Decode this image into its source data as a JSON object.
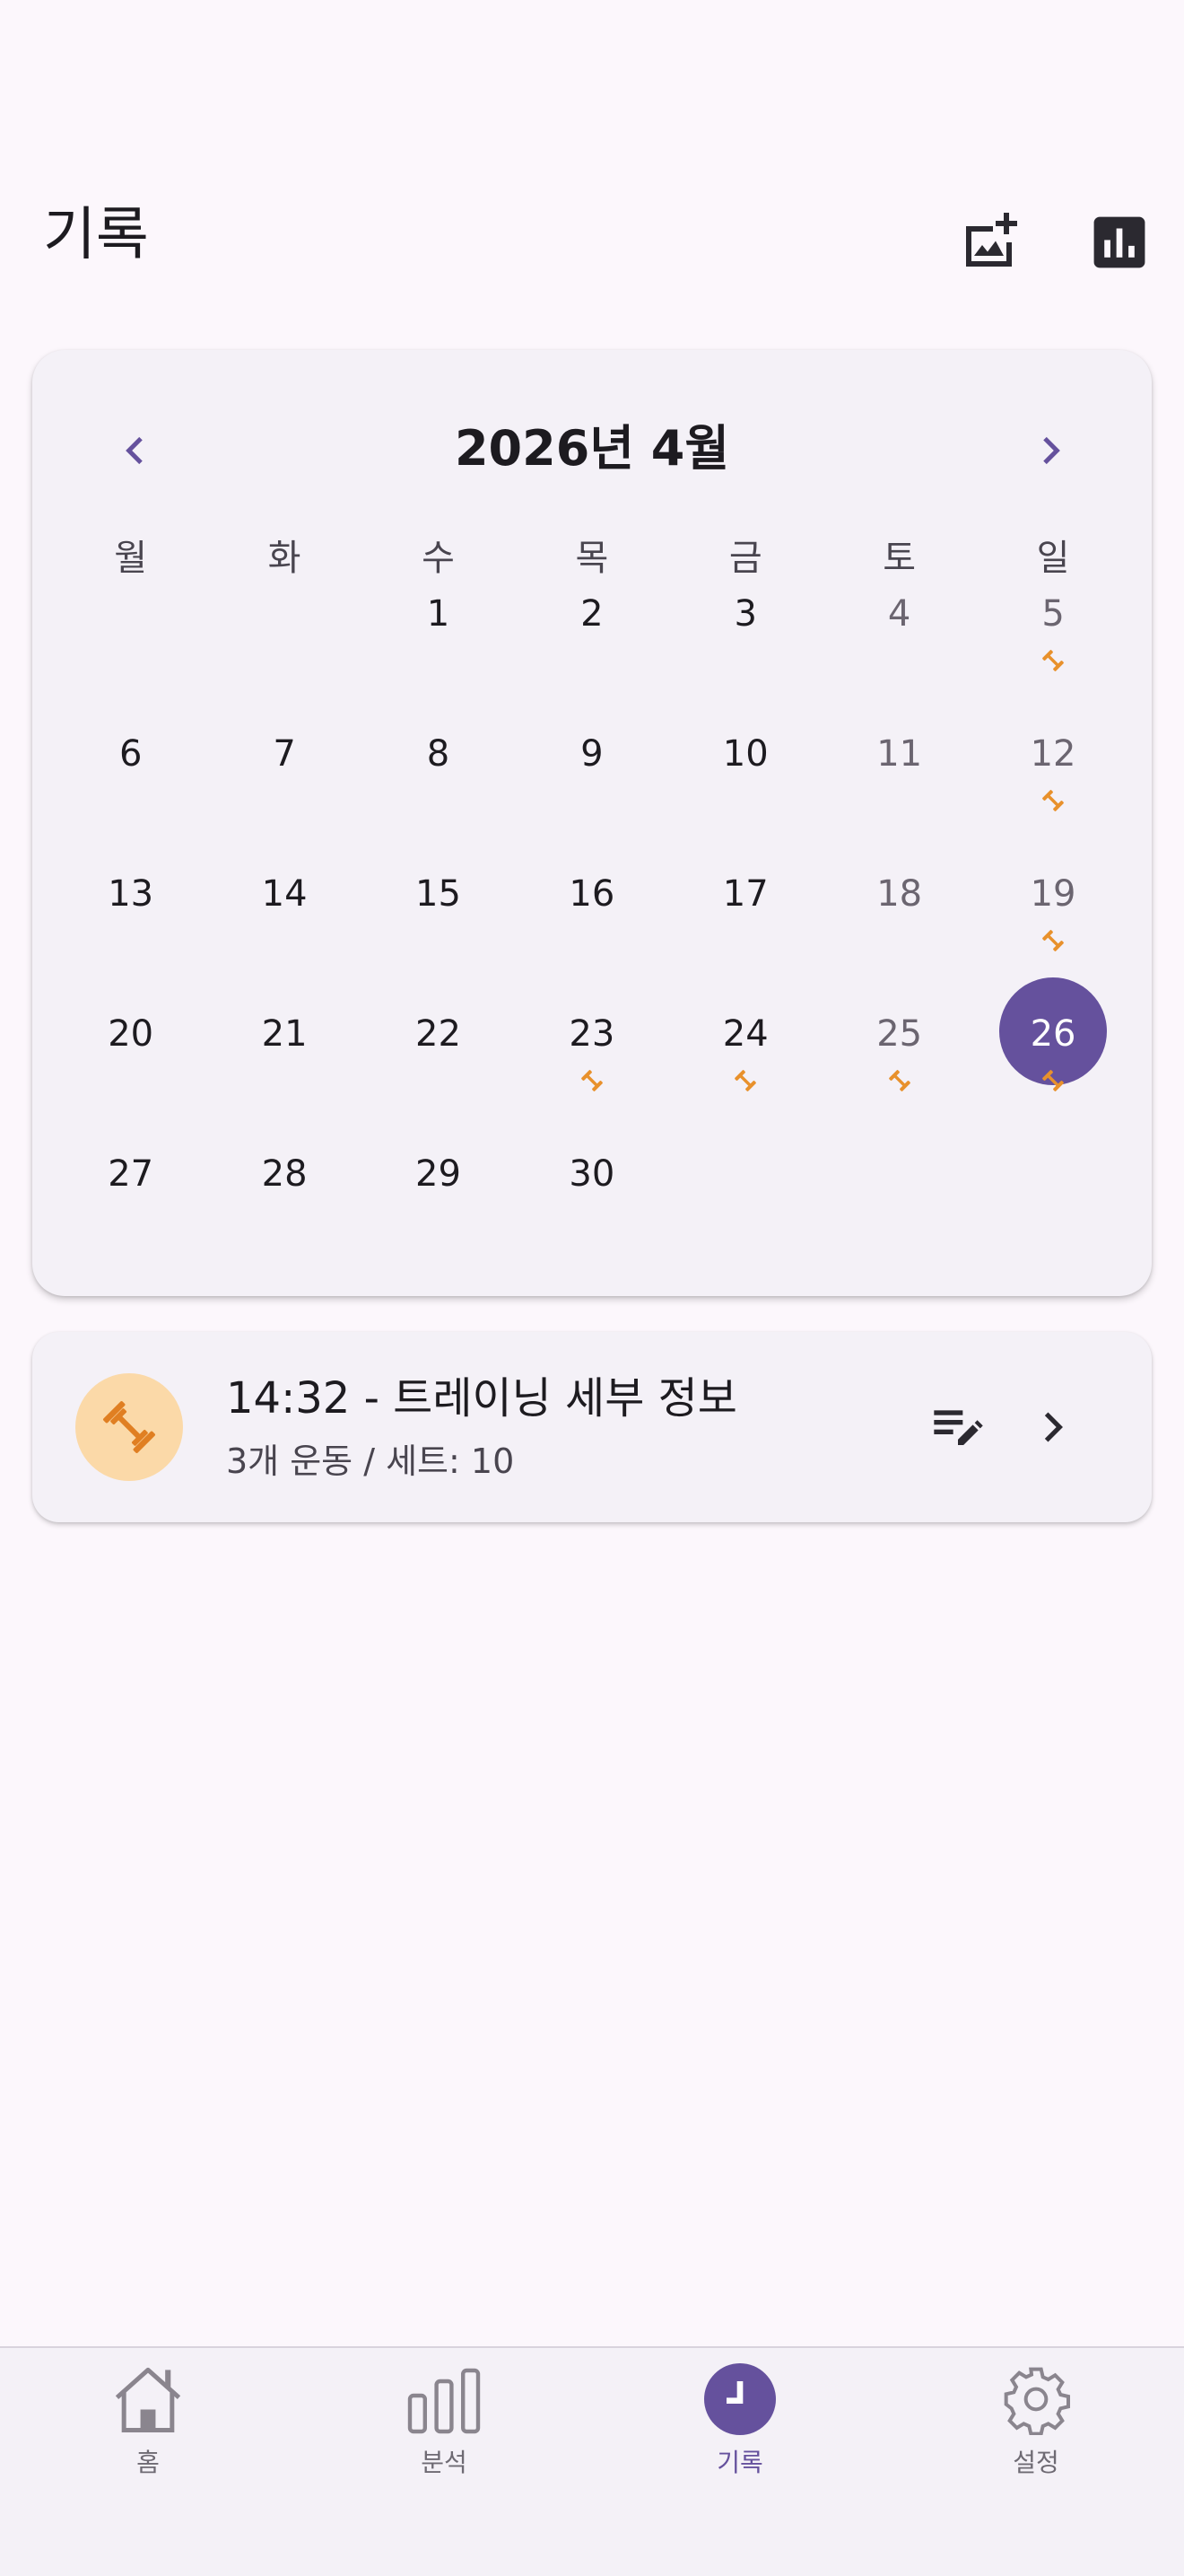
{
  "header": {
    "title": "기록"
  },
  "calendar": {
    "month_title": "2026년 4월",
    "weekdays": [
      "월",
      "화",
      "수",
      "목",
      "금",
      "토",
      "일"
    ],
    "weeks": [
      [
        "",
        "",
        "1",
        "2",
        "3",
        "4",
        "5"
      ],
      [
        "6",
        "7",
        "8",
        "9",
        "10",
        "11",
        "12"
      ],
      [
        "13",
        "14",
        "15",
        "16",
        "17",
        "18",
        "19"
      ],
      [
        "20",
        "21",
        "22",
        "23",
        "24",
        "25",
        "26"
      ],
      [
        "27",
        "28",
        "29",
        "30",
        "",
        "",
        ""
      ]
    ],
    "selected_day": "26",
    "workout_days": [
      "5",
      "12",
      "19",
      "23",
      "24",
      "25",
      "26"
    ]
  },
  "workout": {
    "title": "14:32 - 트레이닝 세부 정보",
    "subtitle": "3개 운동 / 세트: 10"
  },
  "nav": {
    "items": [
      {
        "label": "홈",
        "icon": "home-icon"
      },
      {
        "label": "분석",
        "icon": "bar-chart-icon"
      },
      {
        "label": "기록",
        "icon": "clock-icon"
      },
      {
        "label": "설정",
        "icon": "gear-icon"
      }
    ],
    "active": "기록"
  },
  "colors": {
    "accent": "#65519d",
    "workout_mark": "#e8912c",
    "avatar_bg": "#fbd9a8"
  }
}
